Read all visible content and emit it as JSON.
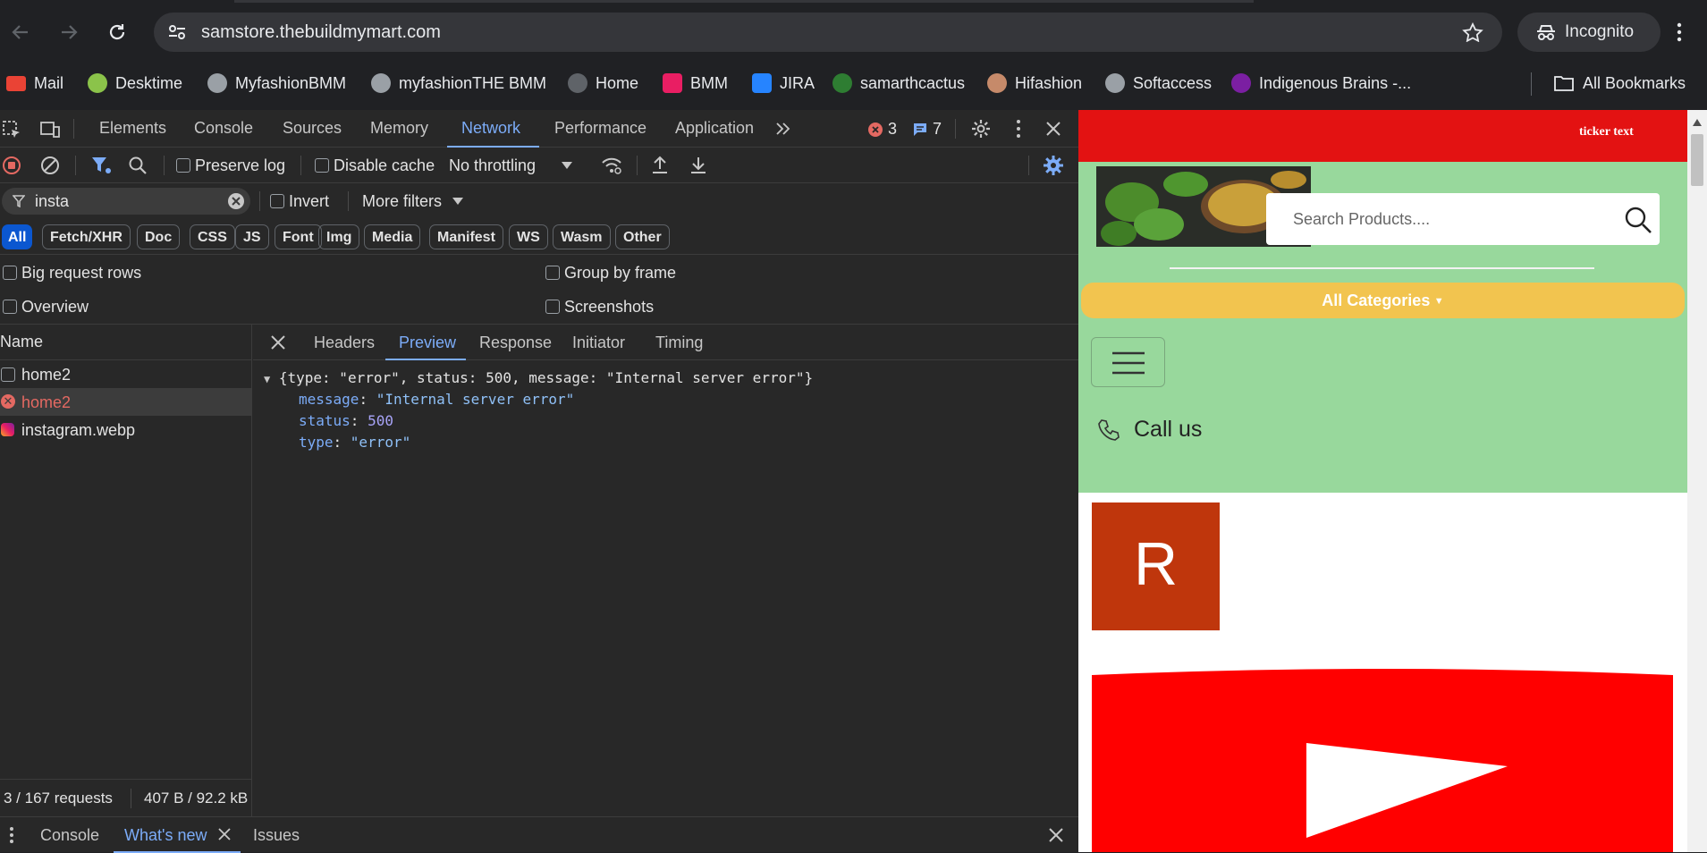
{
  "browser": {
    "url": "samstore.thebuildmymart.com",
    "incognito_label": "Incognito",
    "bookmarks": [
      {
        "label": "Mail",
        "icon": "gmail-icon",
        "color": "#ea4335"
      },
      {
        "label": "Desktime",
        "icon": "desktime-icon",
        "color": "#8bc34a"
      },
      {
        "label": "MyfashionBMM",
        "icon": "globe-icon",
        "color": "#9aa0a6"
      },
      {
        "label": "myfashionTHE BMM",
        "icon": "globe-icon",
        "color": "#9aa0a6"
      },
      {
        "label": "Home",
        "icon": "globe-icon",
        "color": "#5f6368"
      },
      {
        "label": "BMM",
        "icon": "bmm-icon",
        "color": "#e91e63"
      },
      {
        "label": "JIRA",
        "icon": "jira-icon",
        "color": "#2684ff"
      },
      {
        "label": "samarthcactus",
        "icon": "cactus-icon",
        "color": "#2e7d32"
      },
      {
        "label": "Hifashion",
        "icon": "avatar-icon",
        "color": "#c68a6a"
      },
      {
        "label": "Softaccess",
        "icon": "globe-icon",
        "color": "#9aa0a6"
      },
      {
        "label": "Indigenous Brains -...",
        "icon": "indigenous-icon",
        "color": "#7b1fa2"
      }
    ],
    "all_bookmarks": "All Bookmarks"
  },
  "devtools": {
    "tabs": [
      "Elements",
      "Console",
      "Sources",
      "Memory",
      "Network",
      "Performance",
      "Application"
    ],
    "selected_tab": "Network",
    "error_count": "3",
    "message_count": "7",
    "preserve_log": "Preserve log",
    "disable_cache": "Disable cache",
    "throttling": "No throttling",
    "filter_value": "insta",
    "invert": "Invert",
    "more_filters": "More filters",
    "type_filters": [
      "All",
      "Fetch/XHR",
      "Doc",
      "CSS",
      "JS",
      "Font",
      "Img",
      "Media",
      "Manifest",
      "WS",
      "Wasm",
      "Other"
    ],
    "options": {
      "big_rows": "Big request rows",
      "group_by_frame": "Group by frame",
      "overview": "Overview",
      "screenshots": "Screenshots"
    },
    "name_header": "Name",
    "requests": [
      {
        "name": "home2",
        "status": "normal"
      },
      {
        "name": "home2",
        "status": "error"
      },
      {
        "name": "instagram.webp",
        "status": "image"
      }
    ],
    "detail_tabs": [
      "Headers",
      "Preview",
      "Response",
      "Initiator",
      "Timing"
    ],
    "selected_detail": "Preview",
    "preview": {
      "summary": "{type: \"error\", status: 500, message: \"Internal server error\"}",
      "props": [
        {
          "key": "message",
          "value": "\"Internal server error\"",
          "kind": "string"
        },
        {
          "key": "status",
          "value": "500",
          "kind": "number"
        },
        {
          "key": "type",
          "value": "\"error\"",
          "kind": "string"
        }
      ]
    },
    "status_bar": {
      "requests": "3 / 167 requests",
      "transfer": "407 B / 92.2 kB"
    },
    "drawer_tabs": [
      "Console",
      "What's new",
      "Issues"
    ],
    "selected_drawer": "What's new"
  },
  "page": {
    "ticker": "ticker text",
    "search_placeholder": "Search Products....",
    "categories": "All Categories",
    "call_us": "Call us",
    "avatar_letter": "R",
    "colors": {
      "ticker_bg": "#e31212",
      "header_bg": "#98d89c",
      "category_bg": "#f2c44f",
      "avatar_bg": "#bf360c",
      "youtube_red": "#ff0000"
    }
  }
}
